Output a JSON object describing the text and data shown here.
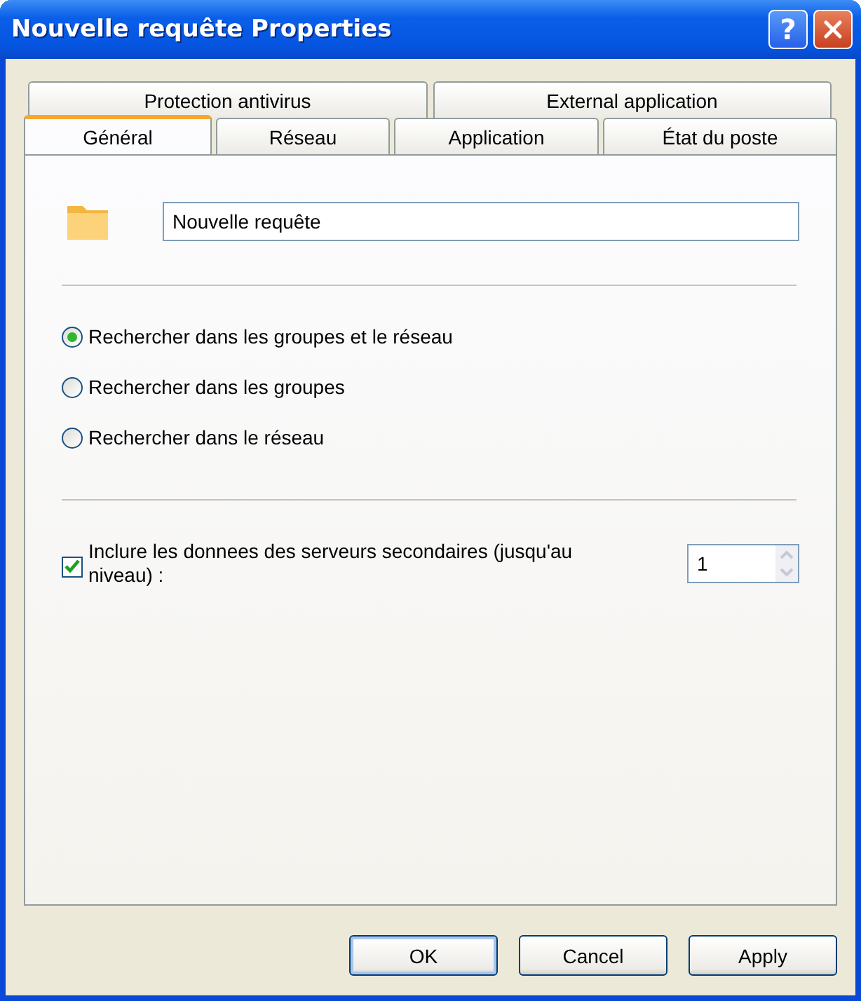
{
  "window": {
    "title": "Nouvelle requête Properties",
    "help_button": "?"
  },
  "tab_rows": [
    [
      {
        "label": "Protection antivirus",
        "selected": false
      },
      {
        "label": "External application",
        "selected": false
      }
    ],
    [
      {
        "label": "Général",
        "selected": true
      },
      {
        "label": "Réseau",
        "selected": false
      },
      {
        "label": "Application",
        "selected": false
      },
      {
        "label": "État du poste",
        "selected": false
      }
    ]
  ],
  "name_field": {
    "value": "Nouvelle requête"
  },
  "radios": [
    {
      "label": "Rechercher dans les groupes et le réseau",
      "selected": true
    },
    {
      "label": "Rechercher dans les groupes",
      "selected": false
    },
    {
      "label": "Rechercher dans le réseau",
      "selected": false
    }
  ],
  "checkbox": {
    "label": "Inclure les donnees des serveurs secondaires (jusqu'au niveau) :",
    "checked": true
  },
  "spinner": {
    "value": "1"
  },
  "buttons": [
    {
      "label": "OK",
      "default": true
    },
    {
      "label": "Cancel",
      "default": false
    },
    {
      "label": "Apply",
      "default": false
    }
  ]
}
